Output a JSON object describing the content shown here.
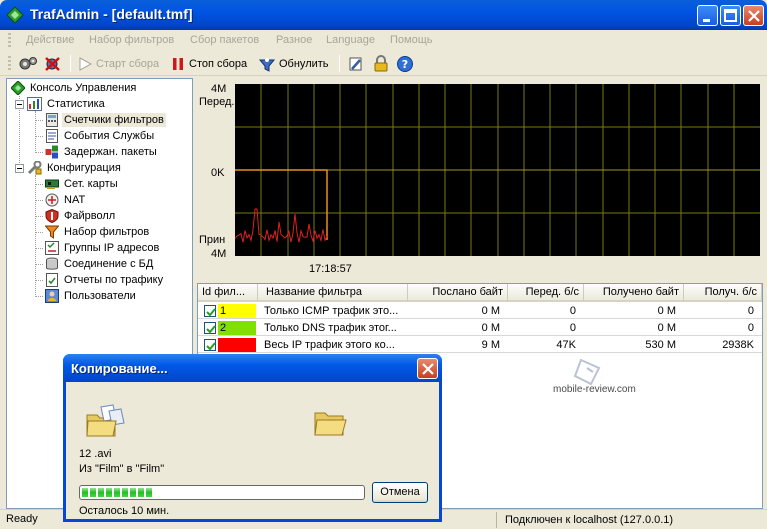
{
  "window": {
    "title": "TrafAdmin - [default.tmf]"
  },
  "menu": {
    "items": [
      "Действие",
      "Набор фильтров",
      "Сбор пакетов",
      "Разное",
      "Language",
      "Помощь"
    ]
  },
  "toolbar": {
    "start_label": "Старт сбора",
    "stop_label": "Стоп сбора",
    "reset_label": "Обнулить"
  },
  "tree": {
    "root": "Консоль Управления",
    "statistics": "Статистика",
    "statistics_items": [
      "Счетчики фильтров",
      "События Службы",
      "Задержан. пакеты"
    ],
    "config": "Конфигурация",
    "config_items": [
      "Сет. карты",
      "NAT",
      "Файрволл",
      "Набор фильтров",
      "Группы IP адресов",
      "Соединение с БД",
      "Отчеты по трафику",
      "Пользователи"
    ]
  },
  "graph": {
    "top_label_value": "4M",
    "top_label_dir": "Перед.",
    "mid_label": "0K",
    "bottom_label_dir": "Прин",
    "bottom_label_value": "4M",
    "time_label": "17:18:57"
  },
  "table": {
    "headers": [
      "Id фил...",
      "Название фильтра",
      "Послано байт",
      "Перед. б/с",
      "Получено байт",
      "Получ. б/с"
    ],
    "rows": [
      {
        "id": "1",
        "color": "#ffff00",
        "name": "Только ICMP трафик это...",
        "sent": "0 M",
        "send_rate": "0",
        "received": "0 M",
        "recv_rate": "0"
      },
      {
        "id": "2",
        "color": "#80e000",
        "name": "Только DNS трафик этог...",
        "sent": "0 M",
        "send_rate": "0",
        "received": "0 M",
        "recv_rate": "0"
      },
      {
        "id": "",
        "color": "#ff0000",
        "name": "Весь IP трафик этого ко...",
        "sent": "9 M",
        "send_rate": "47K",
        "received": "530 M",
        "recv_rate": "2938K"
      }
    ]
  },
  "watermark": "mobile-review.com",
  "dialog": {
    "title": "Копирование...",
    "file": "12 .avi",
    "from_to": "Из \"Film\" в \"Film\"",
    "progress": 0.26,
    "remaining": "Осталось 10 мин.",
    "cancel_label": "Отмена"
  },
  "status": {
    "left": "Ready",
    "right": "Подключен к localhost (127.0.0.1)"
  }
}
